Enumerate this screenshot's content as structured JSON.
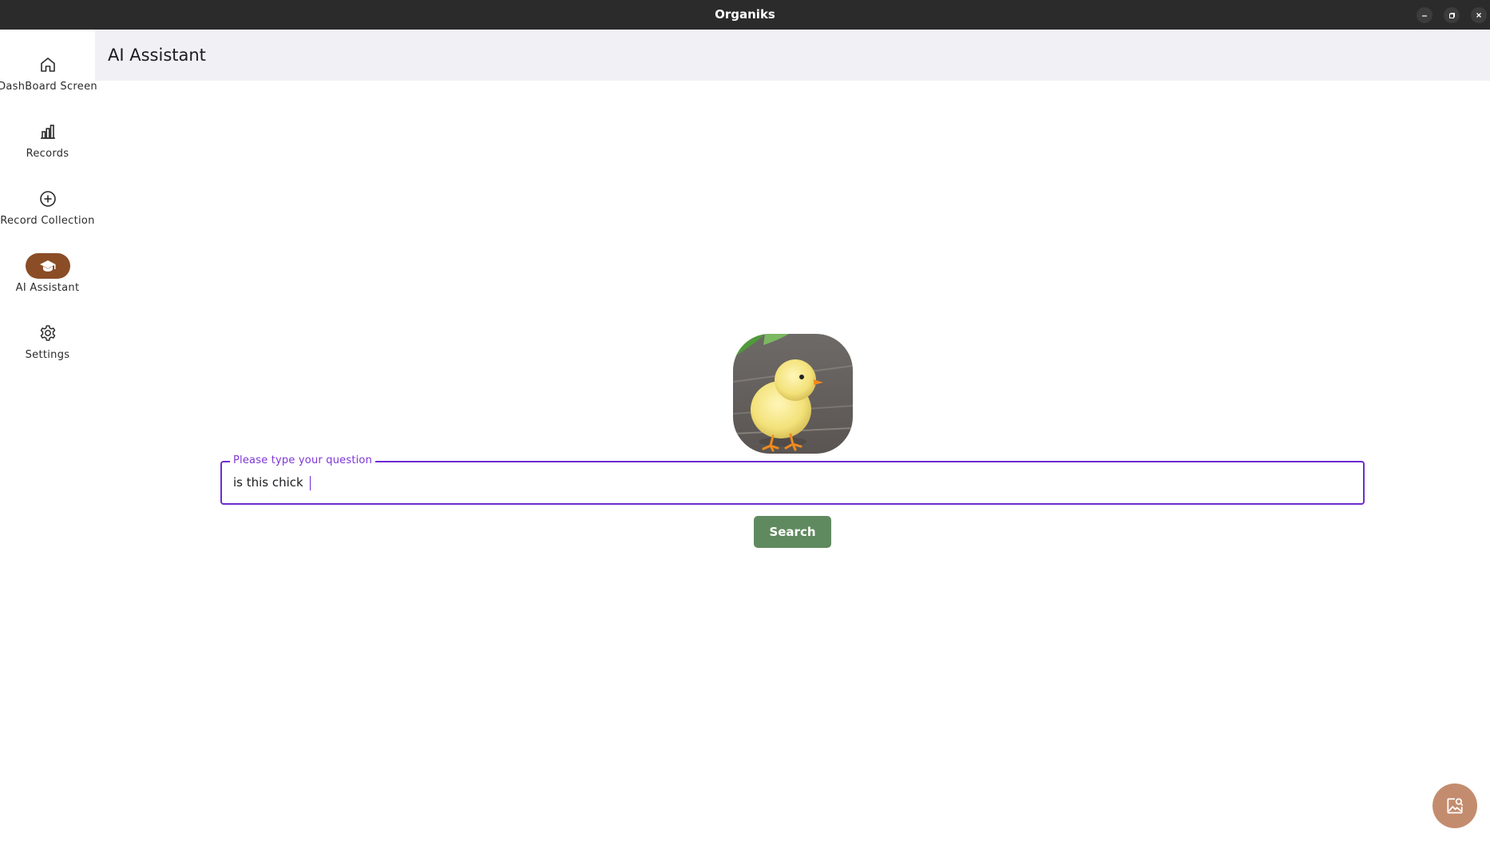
{
  "window": {
    "title": "Organiks",
    "controls": [
      "minimize-icon",
      "restore-icon",
      "close-icon"
    ]
  },
  "sidebar": {
    "items": [
      {
        "label": "DashBoard Screen",
        "icon": "home-icon",
        "active": false
      },
      {
        "label": "Records",
        "icon": "bar-chart-icon",
        "active": false
      },
      {
        "label": "Record Collection",
        "icon": "add-circle-icon",
        "active": false
      },
      {
        "label": "AI Assistant",
        "icon": "graduation-cap-icon",
        "active": true
      },
      {
        "label": "Settings",
        "icon": "gear-icon",
        "active": false
      }
    ]
  },
  "header": {
    "title": "AI Assistant"
  },
  "main": {
    "image": "chick-photo",
    "question_field": {
      "label": "Please type your question",
      "value": "is this chick "
    },
    "search_button": "Search",
    "fab_icon": "image-search-icon"
  },
  "colors": {
    "titlebar": "#2b2b2b",
    "active_nav": "#8a4d26",
    "field_border": "#6f2bd0",
    "field_label": "#7e36d6",
    "search_button": "#5f8a5f",
    "fab": "#c48c6e",
    "appbar": "#f1f0f4"
  }
}
